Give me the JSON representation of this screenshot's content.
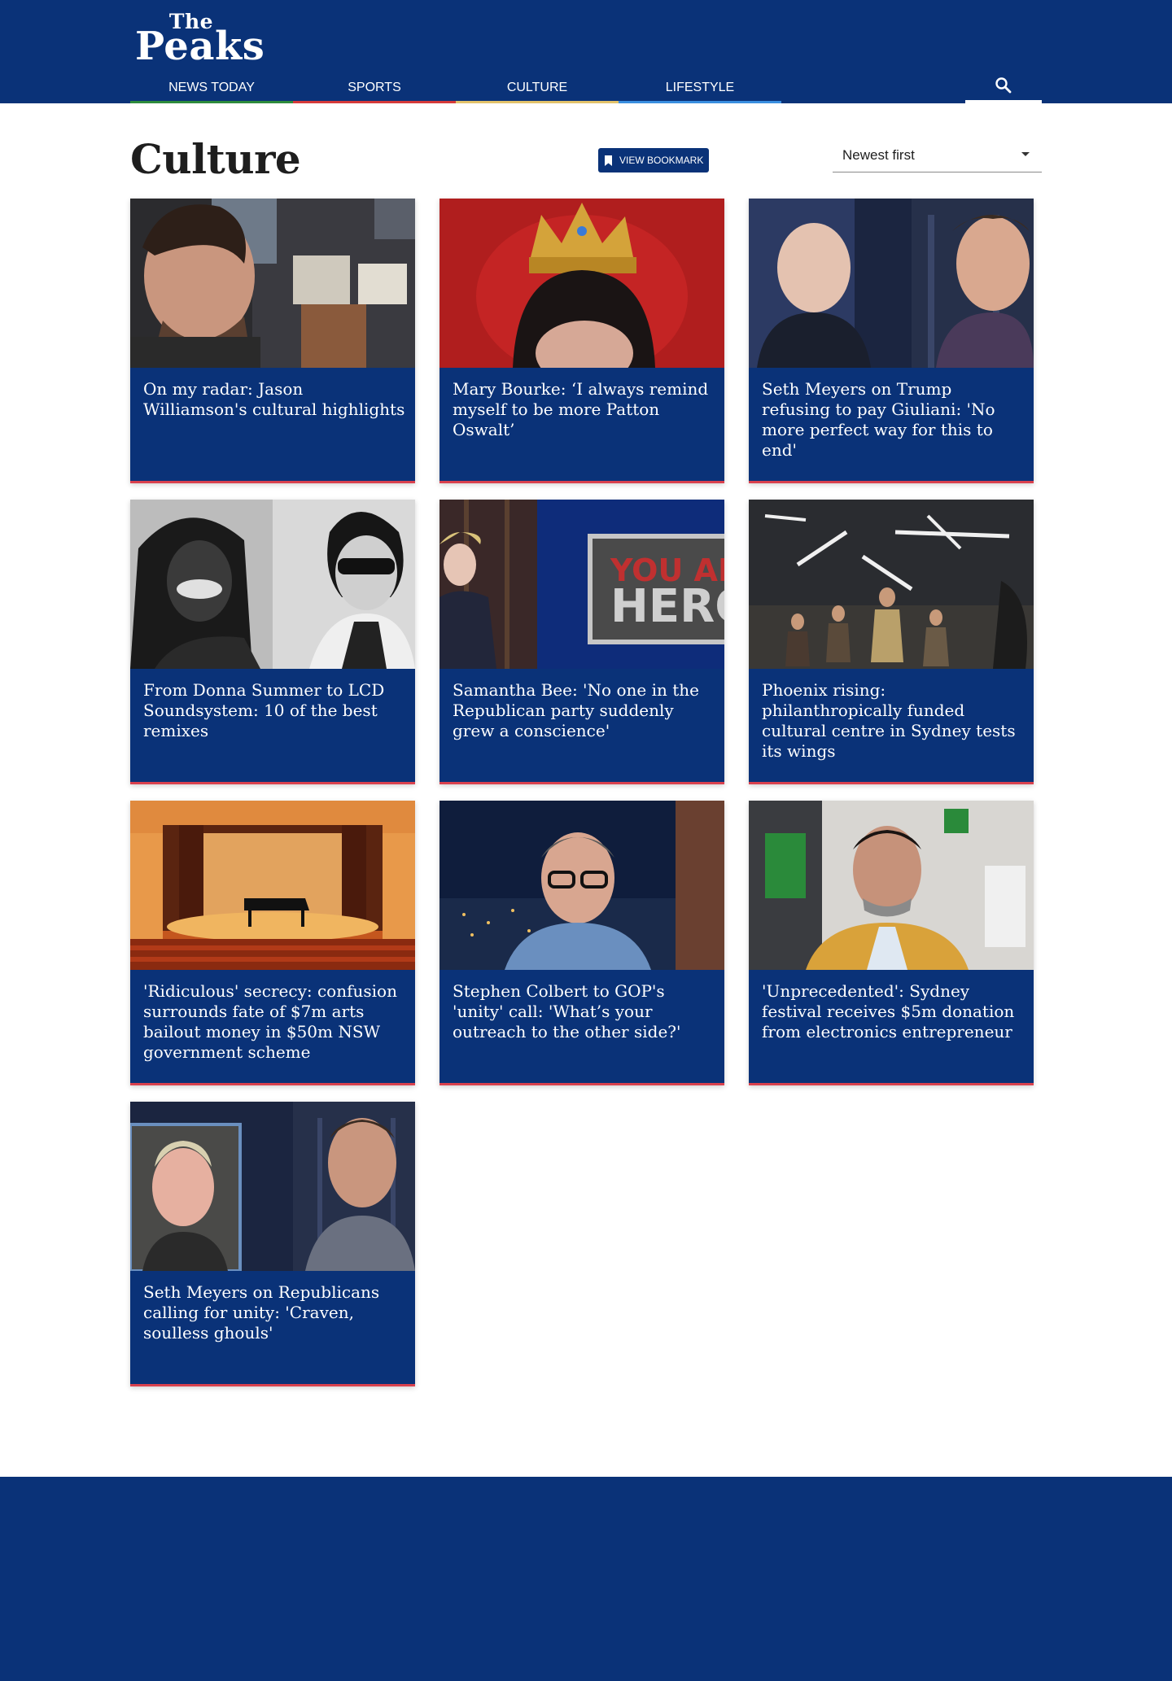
{
  "header": {
    "logo_the": "The",
    "logo_peaks": "Peaks",
    "nav": [
      {
        "label": "NEWS TODAY",
        "color": "#2e8b3d"
      },
      {
        "label": "SPORTS",
        "color": "#d63a3a"
      },
      {
        "label": "CULTURE",
        "color": "#e3c26a"
      },
      {
        "label": "LIFESTYLE",
        "color": "#3a8fe0"
      }
    ],
    "search_icon": "search-icon"
  },
  "page": {
    "title": "Culture",
    "bookmark_label": "VIEW BOOKMARK",
    "sort_value": "Newest first"
  },
  "articles": [
    {
      "headline": "On my radar: Jason Williamson's cultural highlights"
    },
    {
      "headline": "Mary Bourke: ‘I always remind myself to be more Patton Oswalt’"
    },
    {
      "headline": "Seth Meyers on Trump refusing to pay Giuliani: 'No more perfect way for this to end'"
    },
    {
      "headline": "From Donna Summer to LCD Soundsystem: 10 of the best remixes"
    },
    {
      "headline": "Samantha Bee: 'No one in the Republican party suddenly grew a conscience'"
    },
    {
      "headline": "Phoenix rising: philanthropically funded cultural centre in Sydney tests its wings"
    },
    {
      "headline": "'Ridiculous' secrecy: confusion surrounds fate of $7m arts bailout money in $50m NSW government scheme"
    },
    {
      "headline": "Stephen Colbert to GOP's 'unity' call: 'What’s your outreach to the other side?'"
    },
    {
      "headline": "'Unprecedented': Sydney festival receives $5m donation from electronics entrepreneur"
    },
    {
      "headline": "Seth Meyers on Republicans calling for unity: 'Craven, soulless ghouls'"
    }
  ],
  "colors": {
    "brand_navy": "#0a3278",
    "card_accent": "#d9414e"
  }
}
